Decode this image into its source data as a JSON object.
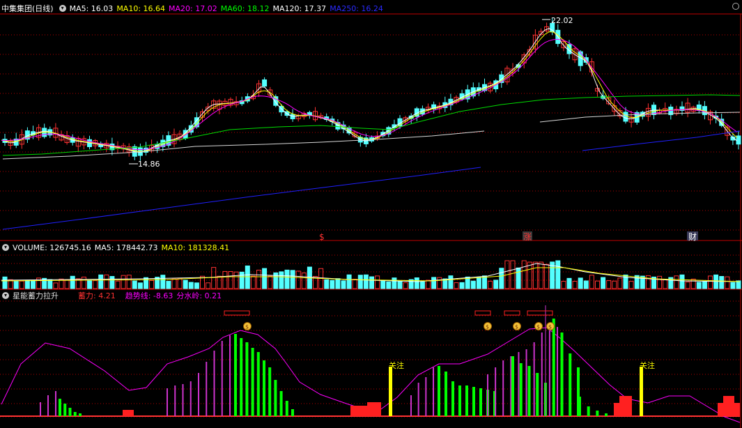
{
  "main_panel": {
    "title": "中集集团(日线)",
    "ma": [
      {
        "label": "MA5: 16.03",
        "color": "#ffffff"
      },
      {
        "label": "MA10: 16.64",
        "color": "#ffff00"
      },
      {
        "label": "MA20: 17.02",
        "color": "#ff00ff"
      },
      {
        "label": "MA60: 18.12",
        "color": "#00ff00"
      },
      {
        "label": "MA120: 17.37",
        "color": "#ffffff"
      },
      {
        "label": "MA250: 16.24",
        "color": "#0000ff"
      }
    ],
    "high_label": "22.02",
    "low_label": "14.86",
    "markers": [
      "$",
      "涨",
      "财"
    ]
  },
  "volume_panel": {
    "title": "VOLUME: 126745.16",
    "ma5": "MA5: 178442.73",
    "ma10": "MA10: 181328.41"
  },
  "indicator_panel": {
    "title": "星能蓄力拉升",
    "xuli": "蓄力: 4.21",
    "trend": "趋势线: -8.63",
    "watershed": "分水岭: 0.21",
    "watch_labels": [
      "关注",
      "关注"
    ]
  },
  "colors": {
    "up": "#ff3232",
    "down": "#54ffff",
    "grid": "#8b0000",
    "dot": "#b40000",
    "panel_line": "#c00000"
  },
  "chart_data": {
    "type": "candlestick",
    "price_high": 22.02,
    "price_low": 14.86,
    "last_volume": 126745.16,
    "indicator": {
      "xuli": 4.21,
      "trend": -8.63,
      "watershed": 0.21
    }
  }
}
